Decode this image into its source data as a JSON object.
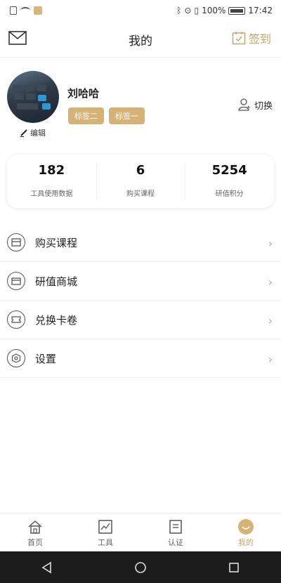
{
  "status_bar": {
    "battery": "100%",
    "time": "17:42"
  },
  "header": {
    "title": "我的",
    "sign_in_label": "签到"
  },
  "profile": {
    "name": "刘哈哈",
    "edit_label": "编辑",
    "tags": [
      "标签二",
      "标签一"
    ],
    "switch_label": "切换"
  },
  "stats": [
    {
      "value": "182",
      "label": "工具使用数据"
    },
    {
      "value": "6",
      "label": "购买课程"
    },
    {
      "value": "5254",
      "label": "研值积分"
    }
  ],
  "menu": [
    {
      "label": "购买课程",
      "icon": "course-icon"
    },
    {
      "label": "研值商城",
      "icon": "store-icon"
    },
    {
      "label": "兑换卡卷",
      "icon": "ticket-icon"
    },
    {
      "label": "设置",
      "icon": "settings-icon"
    }
  ],
  "tabbar": [
    {
      "label": "首页",
      "icon": "home-icon"
    },
    {
      "label": "工具",
      "icon": "chart-icon"
    },
    {
      "label": "认证",
      "icon": "document-icon"
    },
    {
      "label": "我的",
      "icon": "smile-icon",
      "active": true
    }
  ],
  "colors": {
    "accent": "#c7a56b",
    "tag_bg": "#d6b277",
    "nav_bg": "#1c1c1c"
  }
}
